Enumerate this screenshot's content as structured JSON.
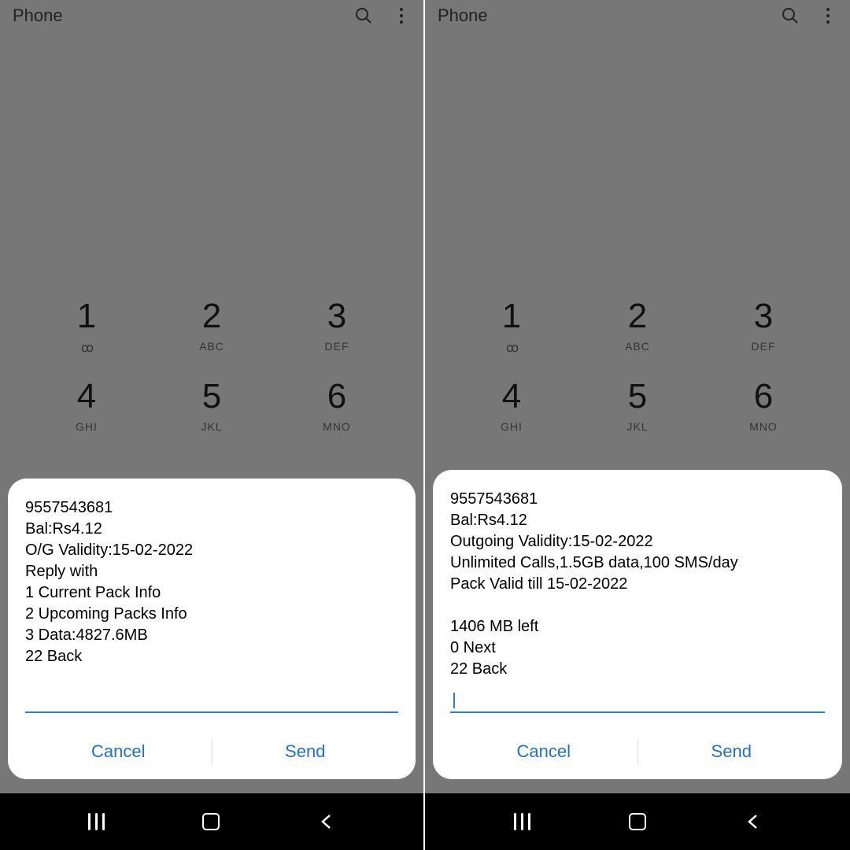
{
  "app_title": "Phone",
  "dialpad": {
    "row1": [
      {
        "num": "1",
        "sub": "ꝏ"
      },
      {
        "num": "2",
        "sub": "ABC"
      },
      {
        "num": "3",
        "sub": "DEF"
      }
    ],
    "row2": [
      {
        "num": "4",
        "sub": "GHI"
      },
      {
        "num": "5",
        "sub": "JKL"
      },
      {
        "num": "6",
        "sub": "MNO"
      }
    ]
  },
  "left_popup": {
    "lines": "9557543681\nBal:Rs4.12\nO/G Validity:15-02-2022\nReply with\n1 Current Pack Info\n2 Upcoming Packs Info\n3 Data:4827.6MB\n22 Back",
    "cancel": "Cancel",
    "send": "Send"
  },
  "right_popup": {
    "lines": "9557543681\nBal:Rs4.12\nOutgoing Validity:15-02-2022\nUnlimited Calls,1.5GB data,100 SMS/day\nPack Valid till 15-02-2022\n\n1406 MB left\n0 Next\n22 Back",
    "cancel": "Cancel",
    "send": "Send"
  }
}
